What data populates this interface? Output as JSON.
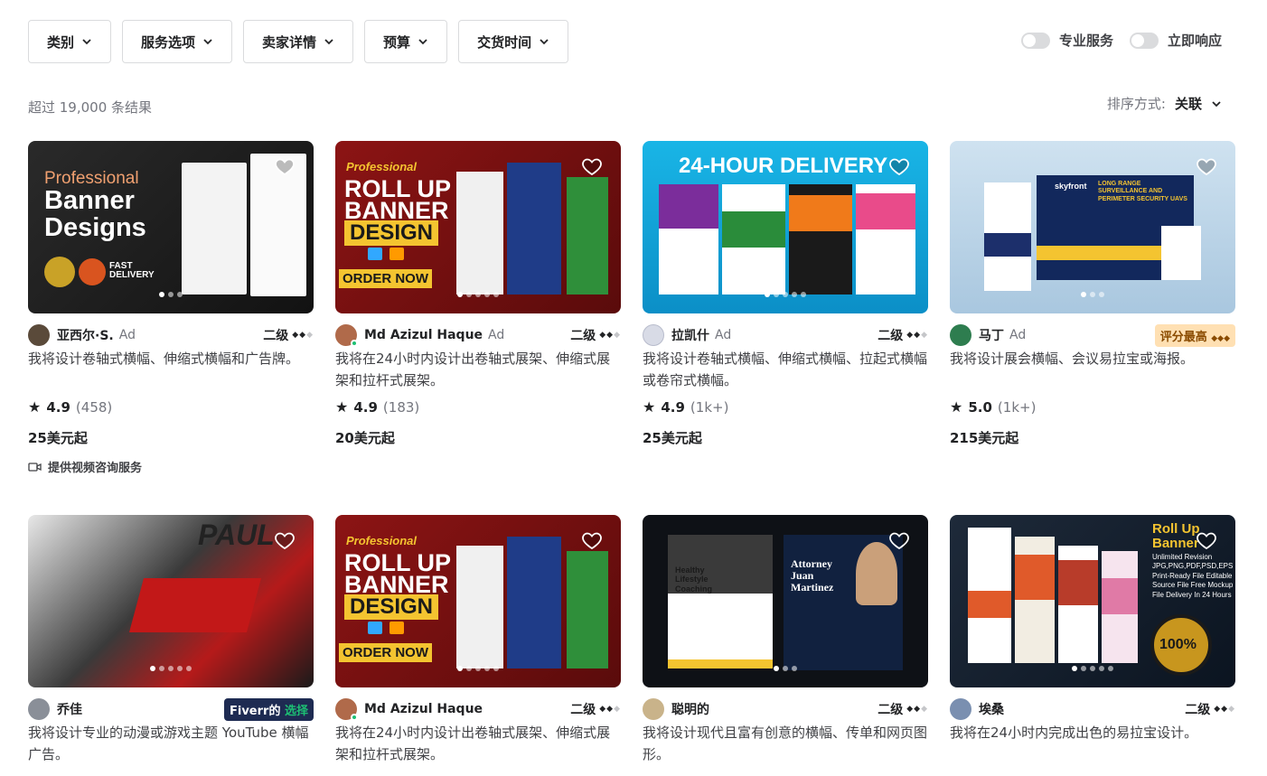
{
  "filters": [
    {
      "label": "类别"
    },
    {
      "label": "服务选项"
    },
    {
      "label": "卖家详情"
    },
    {
      "label": "预算"
    },
    {
      "label": "交货时间"
    }
  ],
  "toggles": [
    {
      "label": "专业服务"
    },
    {
      "label": "立即响应"
    }
  ],
  "results": "超过 19,000 条结果",
  "sort": {
    "label": "排序方式:",
    "value": "关联"
  },
  "icons": {
    "heart": "heart-icon",
    "star": "star-icon",
    "chevron": "chevron-down-icon",
    "video": "video-icon"
  },
  "thumb_texts": {
    "c1": {
      "l1": "Professional",
      "l2": "Banner",
      "l3": "Designs",
      "badge": "FAST DELIVERY"
    },
    "c2": {
      "l1": "Professional",
      "l2": "ROLL UP",
      "l3": "BANNER",
      "l4": "DESIGN",
      "l5": "ORDER NOW"
    },
    "c3": {
      "l1": "24-HOUR DELIVERY"
    },
    "c4": {
      "l1": "skyfront",
      "l2": "LONG RANGE SURVEILLANCE AND PERIMETER SECURITY UAVS"
    },
    "c5": {
      "l1": "PAUL"
    },
    "c7": {
      "l1": "Healthy Lifestyle Coaching",
      "l2": "Attorney Juan Martinez"
    },
    "c8": {
      "l1": "Roll Up Banner",
      "l2": "Unlimited Revision JPG,PNG,PDF,PSD,EPS Print-Ready File Editable Source File Free Mockup File Delivery In 24 Hours",
      "l3": "100%"
    }
  },
  "cards": [
    {
      "seller": "亚西尔·S.",
      "ad": "Ad",
      "level": "二级",
      "title": "我将设计卷轴式横幅、伸缩式横幅和广告牌。",
      "score": "4.9",
      "count": "(458)",
      "price": "25美元起",
      "video": "提供视频咨询服务"
    },
    {
      "seller": "Md Azizul Haque",
      "ad": "Ad",
      "level": "二级",
      "title": "我将在24小时内设计出卷轴式展架、伸缩式展架和拉杆式展架。",
      "score": "4.9",
      "count": "(183)",
      "price": "20美元起"
    },
    {
      "seller": "拉凯什",
      "ad": "Ad",
      "level": "二级",
      "title": "我将设计卷轴式横幅、伸缩式横幅、拉起式横幅或卷帘式横幅。",
      "score": "4.9",
      "count": "(1k+)",
      "price": "25美元起"
    },
    {
      "seller": "马丁",
      "ad": "Ad",
      "badge": "评分最高",
      "title": "我将设计展会横幅、会议易拉宝或海报。",
      "score": "5.0",
      "count": "(1k+)",
      "price": "215美元起"
    },
    {
      "seller": "乔佳",
      "badge_a": "Fiverr的",
      "badge_b": "选择",
      "title": "我将设计专业的动漫或游戏主题 YouTube 横幅广告。"
    },
    {
      "seller": "Md Azizul Haque",
      "level": "二级",
      "title": "我将在24小时内设计出卷轴式展架、伸缩式展架和拉杆式展架。"
    },
    {
      "seller": "聪明的",
      "level": "二级",
      "title": "我将设计现代且富有创意的横幅、传单和网页图形。"
    },
    {
      "seller": "埃桑",
      "level": "二级",
      "title": "我将在24小时内完成出色的易拉宝设计。"
    }
  ]
}
